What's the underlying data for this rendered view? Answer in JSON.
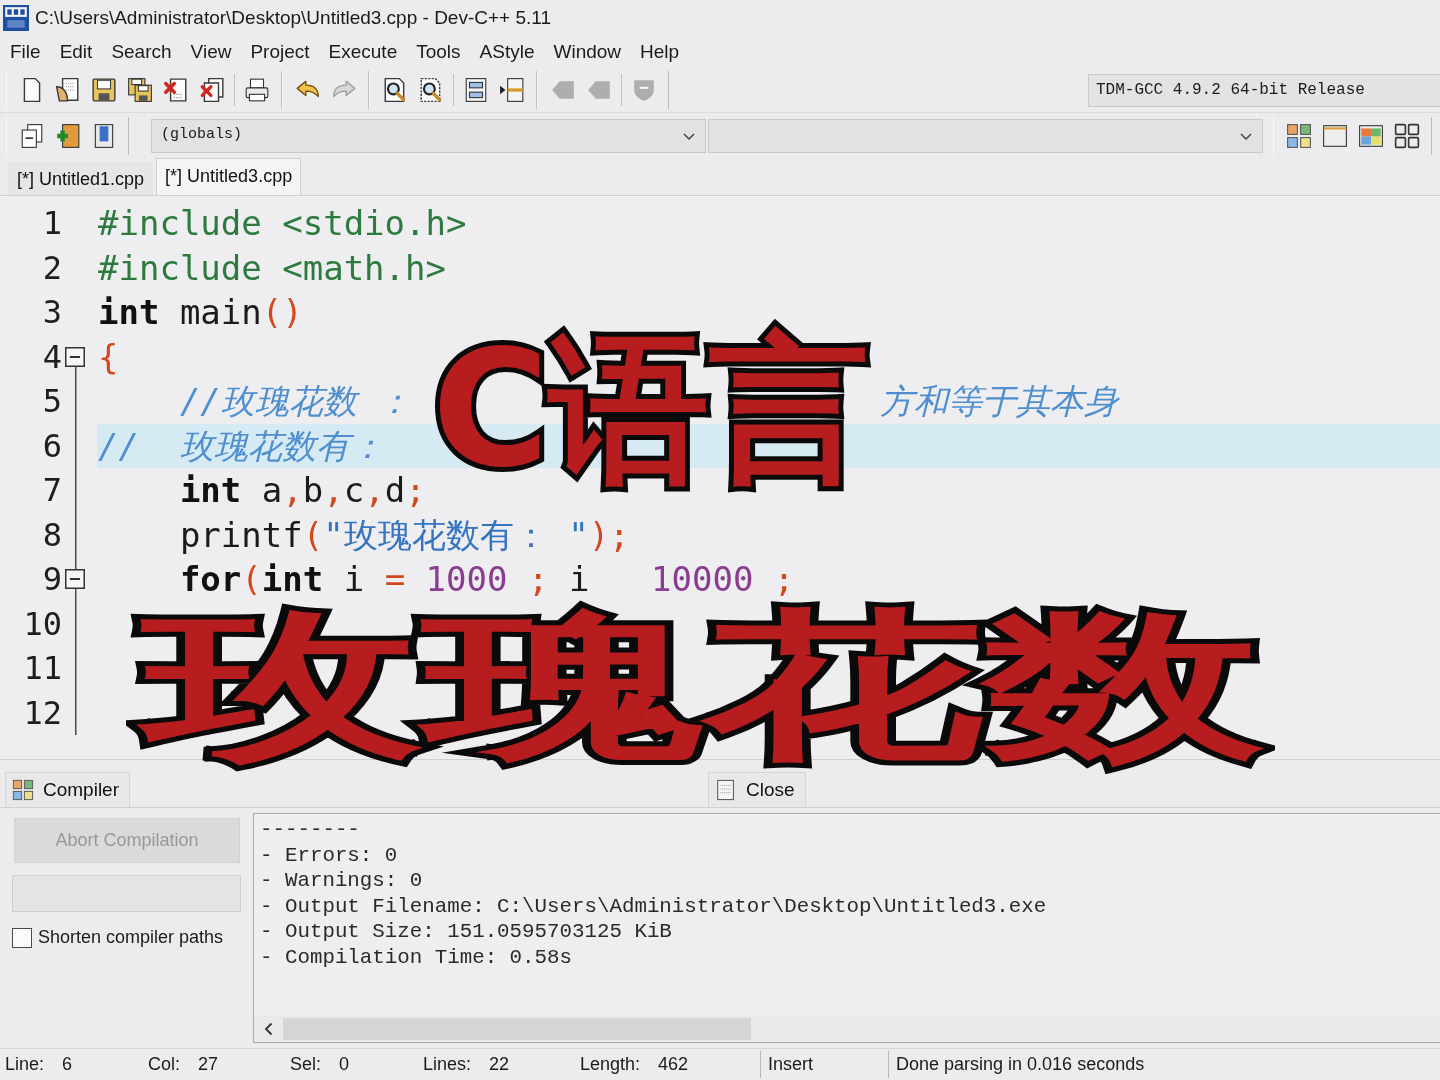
{
  "window": {
    "title": "C:\\Users\\Administrator\\Desktop\\Untitled3.cpp - Dev-C++ 5.11"
  },
  "menu": [
    "File",
    "Edit",
    "Search",
    "View",
    "Project",
    "Execute",
    "Tools",
    "AStyle",
    "Window",
    "Help"
  ],
  "main_toolbar": {
    "groups": [
      {
        "sections": [
          [
            {
              "kind": "new",
              "disabled": false
            },
            {
              "kind": "open",
              "disabled": false
            },
            {
              "kind": "save",
              "disabled": false
            },
            {
              "kind": "saveall",
              "disabled": false
            },
            {
              "kind": "close",
              "disabled": false
            },
            {
              "kind": "closeall",
              "disabled": false
            }
          ],
          [
            {
              "kind": "print",
              "disabled": false
            }
          ]
        ]
      },
      {
        "sections": [
          [
            {
              "kind": "undo",
              "disabled": false
            },
            {
              "kind": "redo",
              "disabled": true
            }
          ]
        ]
      },
      {
        "sections": [
          [
            {
              "kind": "find",
              "disabled": false
            },
            {
              "kind": "replace",
              "disabled": false
            }
          ],
          [
            {
              "kind": "indent",
              "disabled": false
            },
            {
              "kind": "unindent",
              "disabled": false
            }
          ]
        ]
      },
      {
        "sections": [
          [
            {
              "kind": "back",
              "disabled": true
            },
            {
              "kind": "forward",
              "disabled": true
            }
          ],
          [
            {
              "kind": "bookmark",
              "disabled": true
            }
          ]
        ]
      }
    ],
    "compiler": "TDM-GCC 4.9.2 64-bit Release"
  },
  "class_toolbar": {
    "tools": [
      {
        "kind": "pages",
        "disabled": false
      },
      {
        "kind": "addfile",
        "disabled": false
      },
      {
        "kind": "book",
        "disabled": false
      }
    ],
    "scope": "(globals)",
    "layouts": [
      {
        "kind": "tiles",
        "disabled": false
      },
      {
        "kind": "window",
        "disabled": false
      },
      {
        "kind": "tiledwindow",
        "disabled": false
      },
      {
        "kind": "grid",
        "disabled": false
      }
    ]
  },
  "file_tabs": [
    {
      "label": "[*] Untitled1.cpp",
      "selected": false
    },
    {
      "label": "[*] Untitled3.cpp",
      "selected": true
    }
  ],
  "editor": {
    "lines": [
      {
        "number": "1",
        "fold_start": false,
        "highlighted": false,
        "fragments": [
          [
            {
              "kind": "preproc",
              "text": "#include <stdio.h>"
            }
          ]
        ]
      },
      {
        "number": "2",
        "fold_start": false,
        "highlighted": false,
        "fragments": [
          [
            {
              "kind": "preproc",
              "text": "#include <math.h>"
            }
          ]
        ]
      },
      {
        "number": "3",
        "fold_start": false,
        "highlighted": false,
        "fragments": [
          [
            {
              "kind": "keyword",
              "text": "int"
            },
            {
              "kind": "ident",
              "text": " main"
            },
            {
              "kind": "symbol",
              "text": "()"
            }
          ]
        ]
      },
      {
        "number": "4",
        "fold_start": true,
        "highlighted": false,
        "fragments": [
          [
            {
              "kind": "symbol",
              "text": "{"
            }
          ]
        ]
      },
      {
        "number": "5",
        "fold_start": false,
        "highlighted": false,
        "fragments": [
          [
            {
              "kind": "comment",
              "text": "    //玫瑰花数 ："
            }
          ],
          [
            {
              "kind": "comment",
              "text": "方和等于其本身"
            }
          ]
        ]
      },
      {
        "number": "6",
        "fold_start": false,
        "highlighted": true,
        "fragments": [
          [
            {
              "kind": "comment",
              "text": "//  玫瑰花数有："
            }
          ]
        ]
      },
      {
        "number": "7",
        "fold_start": false,
        "highlighted": false,
        "fragments": [
          [
            {
              "kind": "keyword",
              "text": "    int"
            },
            {
              "kind": "ident",
              "text": " a"
            },
            {
              "kind": "symbol",
              "text": ","
            },
            {
              "kind": "ident",
              "text": "b"
            },
            {
              "kind": "symbol",
              "text": ","
            },
            {
              "kind": "ident",
              "text": "c"
            },
            {
              "kind": "symbol",
              "text": ","
            },
            {
              "kind": "ident",
              "text": "d"
            },
            {
              "kind": "symbol",
              "text": ";"
            }
          ]
        ]
      },
      {
        "number": "8",
        "fold_start": false,
        "highlighted": false,
        "fragments": [
          [
            {
              "kind": "ident",
              "text": "    printf"
            },
            {
              "kind": "symbol",
              "text": "("
            },
            {
              "kind": "string",
              "text": "\"玫瑰花数有： \""
            },
            {
              "kind": "symbol",
              "text": ");"
            }
          ]
        ]
      },
      {
        "number": "9",
        "fold_start": true,
        "highlighted": false,
        "fragments": [
          [
            {
              "kind": "keyword",
              "text": "    for"
            },
            {
              "kind": "symbol",
              "text": "("
            },
            {
              "kind": "keyword",
              "text": "int"
            },
            {
              "kind": "ident",
              "text": " i "
            },
            {
              "kind": "symbol",
              "text": "="
            },
            {
              "kind": "number",
              "text": " 1000 "
            },
            {
              "kind": "symbol",
              "text": ";"
            },
            {
              "kind": "ident",
              "text": " i"
            }
          ],
          [
            {
              "kind": "number",
              "text": "10000 "
            },
            {
              "kind": "symbol",
              "text": ";"
            }
          ]
        ]
      },
      {
        "number": "10",
        "fold_start": false,
        "highlighted": false
      },
      {
        "number": "11",
        "fold_start": false,
        "highlighted": false
      },
      {
        "number": "12",
        "fold_start": false,
        "highlighted": false
      }
    ]
  },
  "overlay_title": [
    "C语言",
    "玫瑰花数"
  ],
  "bottom_tabs": [
    {
      "kind": "compiler",
      "label": "Compiler"
    },
    {
      "kind": "close",
      "label": "Close"
    }
  ],
  "compile_panel": {
    "abort_button": {
      "label": "Abort Compilation",
      "disabled": true
    },
    "shorten_paths": {
      "label": "Shorten compiler paths",
      "checked": false
    },
    "log": [
      "--------",
      "- Errors: 0",
      "- Warnings: 0",
      "- Output Filename: C:\\Users\\Administrator\\Desktop\\Untitled3.exe",
      "- Output Size: 151.0595703125 KiB",
      "- Compilation Time: 0.58s"
    ]
  },
  "status_bar": {
    "fields": [
      {
        "label": "Line:",
        "value": "6"
      },
      {
        "label": "Col:",
        "value": "27"
      },
      {
        "label": "Sel:",
        "value": "0"
      },
      {
        "label": "Lines:",
        "value": "22"
      },
      {
        "label": "Length:",
        "value": "462"
      }
    ],
    "mode": "Insert",
    "message": "Done parsing in 0.016 seconds"
  }
}
